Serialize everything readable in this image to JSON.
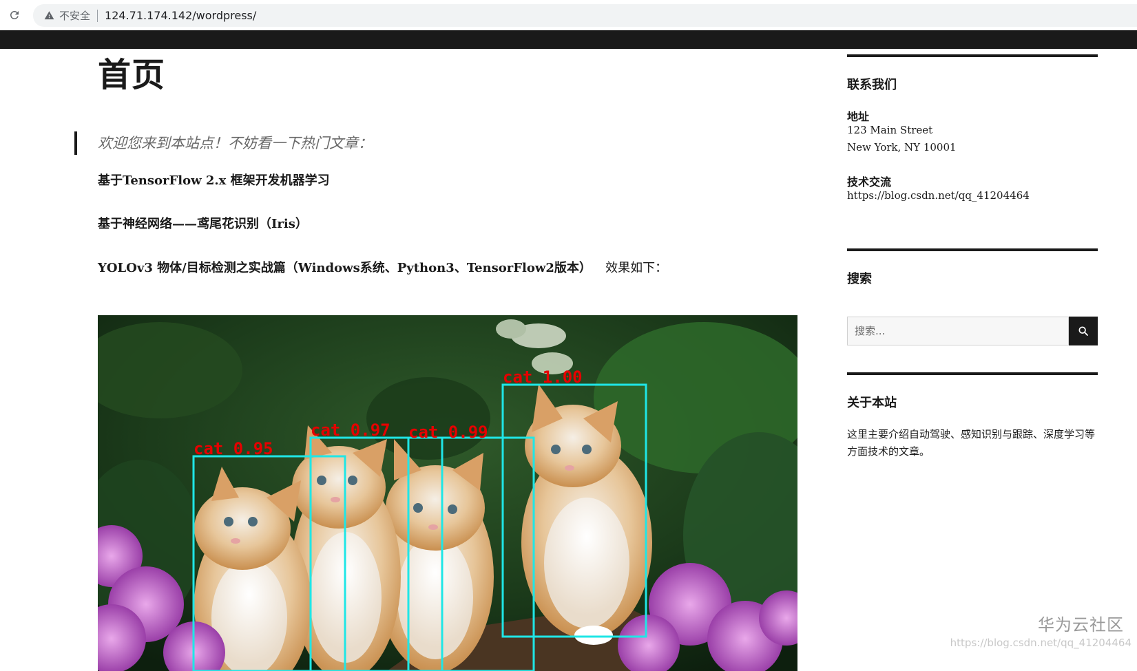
{
  "browser": {
    "security_label": "不安全",
    "url": "124.71.174.142/wordpress/"
  },
  "page": {
    "title": "首页",
    "quote": "欢迎您来到本站点！不妨看一下热门文章：",
    "articles": [
      "基于TensorFlow 2.x 框架开发机器学习",
      "基于神经网络——鸢尾花识别（Iris）"
    ],
    "article3": {
      "link": "YOLOv3 物体/目标检测之实战篇（Windows系统、Python3、TensorFlow2版本）",
      "suffix": "效果如下："
    },
    "detections": [
      {
        "label": "cat 1.00"
      },
      {
        "label": "cat 0.97"
      },
      {
        "label": "cat 0.99"
      },
      {
        "label": "cat 0.95"
      }
    ]
  },
  "sidebar": {
    "contact": {
      "title": "联系我们",
      "address_heading": "地址",
      "address_line1": "123 Main Street",
      "address_line2": "New York, NY 10001",
      "tech_heading": "技术交流",
      "tech_link": "https://blog.csdn.net/qq_41204464"
    },
    "search": {
      "title": "搜索",
      "placeholder": "搜索..."
    },
    "about": {
      "title": "关于本站",
      "text": "这里主要介绍自动驾驶、感知识别与跟踪、深度学习等方面技术的文章。"
    }
  },
  "watermark": {
    "logo": "华为云社区",
    "url": "https://blog.csdn.net/qq_41204464"
  },
  "colors": {
    "detection_box": "#1fe6e6",
    "detection_label": "#e60000",
    "dark": "#1a1a1a"
  }
}
